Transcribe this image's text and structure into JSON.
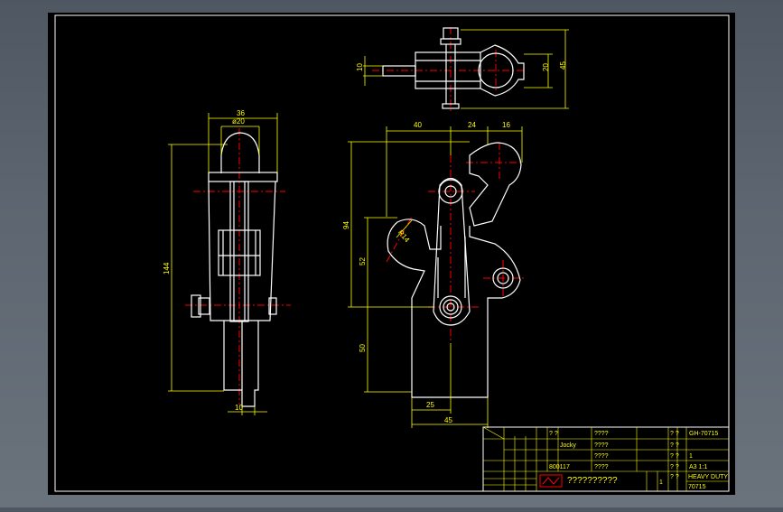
{
  "colors": {
    "background": "#000000",
    "frame": "#ffffff",
    "outline": "#ffffff",
    "dimension": "#ffff00",
    "centerline": "#ff0000",
    "titleblock": "#ffff00"
  },
  "top_view": {
    "dims": {
      "d10": "10",
      "d20": "20",
      "d45": "45"
    }
  },
  "side_view": {
    "dims": {
      "d36": "36",
      "d20": "ø20",
      "d144": "144",
      "d10": "10"
    }
  },
  "front_view": {
    "dims": {
      "d40": "40",
      "d24": "24",
      "d16": "16",
      "d94": "94",
      "d52": "52",
      "d50": "50",
      "d25": "25",
      "d45": "45",
      "r14": "R14"
    }
  },
  "title_block": {
    "drawing_no": "GH-70715",
    "model": "HEAVY DUTY",
    "model_no": "70715",
    "scale": "A3  1:1",
    "company": "??????????",
    "code": "800117",
    "cell_q1": "? ?",
    "cell_q4": "????",
    "jocky": "Jocky",
    "one": "1",
    "page": "1"
  }
}
